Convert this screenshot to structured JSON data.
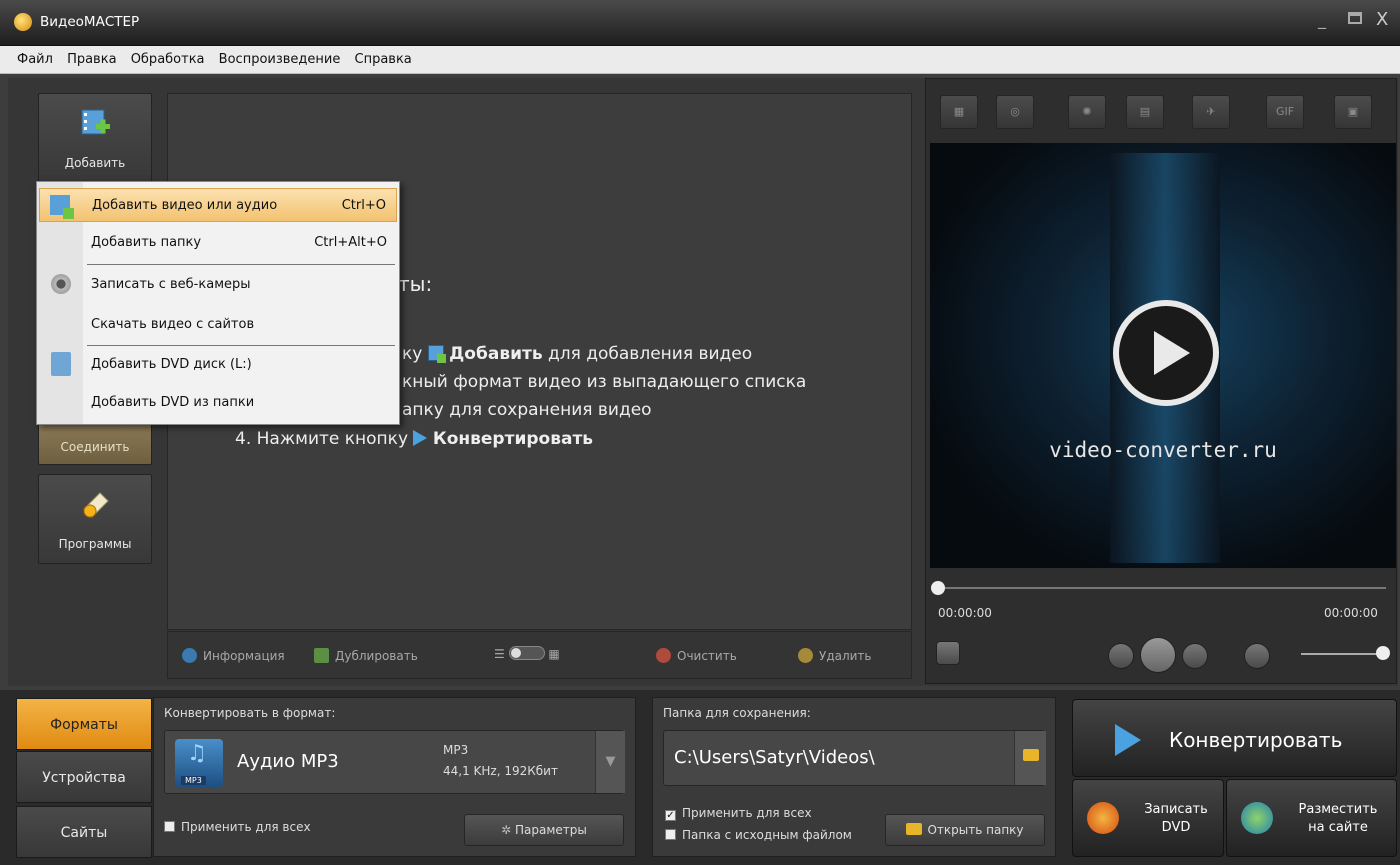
{
  "window": {
    "title": "ВидеоМАСТЕР",
    "min": "_",
    "close": "X"
  },
  "menu": [
    "Файл",
    "Правка",
    "Обработка",
    "Воспроизведение",
    "Справка"
  ],
  "sidebar": {
    "add": "Добавить",
    "join": "Соединить",
    "programs": "Программы"
  },
  "dropdown": {
    "items": [
      {
        "label": "Добавить видео или аудио",
        "shortcut": "Ctrl+O"
      },
      {
        "label": "Добавить папку",
        "shortcut": "Ctrl+Alt+O"
      },
      {
        "label": "Записать с веб-камеры",
        "shortcut": ""
      },
      {
        "label": "Скачать видео с сайтов",
        "shortcut": ""
      },
      {
        "label": "Добавить DVD диск (L:)",
        "shortcut": ""
      },
      {
        "label": "Добавить DVD из папки",
        "shortcut": ""
      }
    ]
  },
  "instructions": {
    "heading_frag": "ты:",
    "l1_pre": "ку",
    "l1_bold": "Добавить",
    "l1_post": "для добавления видео",
    "l2": "кный формат видео из выпадающего списка",
    "l3": "апку для сохранения видео",
    "l4_pre": "4. Нажмите кнопку",
    "l4_bold": "Конвертировать"
  },
  "list_toolbar": {
    "info": "Информация",
    "dup": "Дублировать",
    "clear": "Очистить",
    "delete": "Удалить"
  },
  "preview": {
    "fx_gif": "GIF",
    "site": "video-converter.ru",
    "time_current": "00:00:00",
    "time_total": "00:00:00"
  },
  "tabs": {
    "formats": "Форматы",
    "devices": "Устройства",
    "sites": "Сайты"
  },
  "format": {
    "label": "Конвертировать в формат:",
    "name": "Аудио MP3",
    "icon_badge": "MP3",
    "codec": "MP3",
    "details": "44,1 KHz, 192Кбит",
    "apply_all": "Применить для всех",
    "params": "Параметры"
  },
  "folder": {
    "label": "Папка для сохранения:",
    "path": "C:\\Users\\Satyr\\Videos\\",
    "apply_all": "Применить для всех",
    "source_folder": "Папка с исходным файлом",
    "open": "Открыть папку"
  },
  "actions": {
    "convert": "Конвертировать",
    "burn_l1": "Записать",
    "burn_l2": "DVD",
    "upload_l1": "Разместить",
    "upload_l2": "на сайте"
  },
  "colors": {
    "accent": "#e8a02a",
    "highlight": "#f6c773"
  }
}
